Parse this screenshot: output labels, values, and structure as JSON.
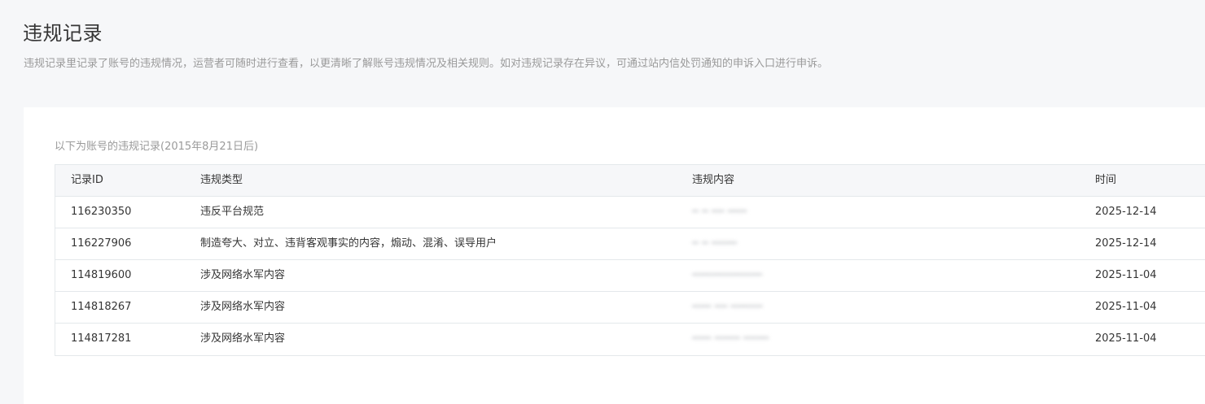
{
  "page": {
    "title": "违规记录",
    "description": "违规记录里记录了账号的违规情况，运营者可随时进行查看，以更清晰了解账号违规情况及相关规则。如对违规记录存在异议，可通过站内信处罚通知的申诉入口进行申诉。"
  },
  "records": {
    "caption": "以下为账号的违规记录(2015年8月21日后)",
    "columns": {
      "id": "记录ID",
      "type": "违规类型",
      "content": "违规内容",
      "time": "时间"
    },
    "rows": [
      {
        "id": "116230350",
        "type": "违反平台规范",
        "content": "╍ ╍ ╍╍ ╍╍╍",
        "time": "2025-12-14"
      },
      {
        "id": "116227906",
        "type": "制造夸大、对立、违背客观事实的内容，煽动、混淆、误导用户",
        "content": "╍ ╍ ╍╍╍╍",
        "time": "2025-12-14"
      },
      {
        "id": "114819600",
        "type": "涉及网络水军内容",
        "content": "╍╍╍╍╍╍╍╍╍╍╍",
        "time": "2025-11-04"
      },
      {
        "id": "114818267",
        "type": "涉及网络水军内容",
        "content": "╍╍╍ ╍╍ ╍╍╍╍╍",
        "time": "2025-11-04"
      },
      {
        "id": "114817281",
        "type": "涉及网络水军内容",
        "content": "╍╍╍ ╍╍╍╍ ╍╍╍╍",
        "time": "2025-11-04"
      }
    ]
  }
}
